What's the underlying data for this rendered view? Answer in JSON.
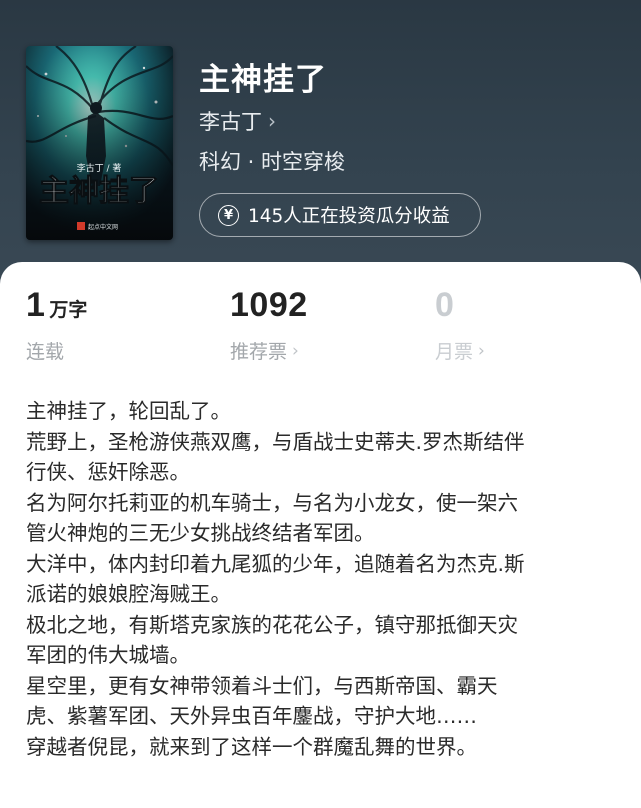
{
  "book": {
    "title": "主神挂了",
    "author": "李古丁",
    "genre": "科幻 · 时空穿梭",
    "investment": "145人正在投资瓜分收益",
    "cover": {
      "title_text": "主神挂了",
      "author_text": "李古丁 / 著",
      "publisher": "起点中文网"
    }
  },
  "stats": [
    {
      "value": "1",
      "unit": "万字",
      "label": "连载",
      "has_chevron": false
    },
    {
      "value": "1092",
      "unit": "",
      "label": "推荐票",
      "has_chevron": true
    },
    {
      "value": "0",
      "unit": "",
      "label": "月票",
      "has_chevron": true
    }
  ],
  "description": [
    "主神挂了，轮回乱了。",
    "荒野上，圣枪游侠燕双鹰，与盾战士史蒂夫.罗杰斯结伴",
    "行侠、惩奸除恶。",
    "名为阿尔托莉亚的机车骑士，与名为小龙女，使一架六",
    "管火神炮的三无少女挑战终结者军团。",
    "大洋中，体内封印着九尾狐的少年，追随着名为杰克.斯",
    "派诺的娘娘腔海贼王。",
    "极北之地，有斯塔克家族的花花公子，镇守那抵御天灾",
    "军团的伟大城墙。",
    "星空里，更有女神带领着斗士们，与西斯帝国、霸天",
    "虎、紫薯军团、天外异虫百年鏖战，守护大地……",
    "穿越者倪昆，就来到了这样一个群魔乱舞的世界。"
  ],
  "icons": {
    "yen": "yen-coin-icon",
    "chevron": "chevron-right-icon"
  }
}
